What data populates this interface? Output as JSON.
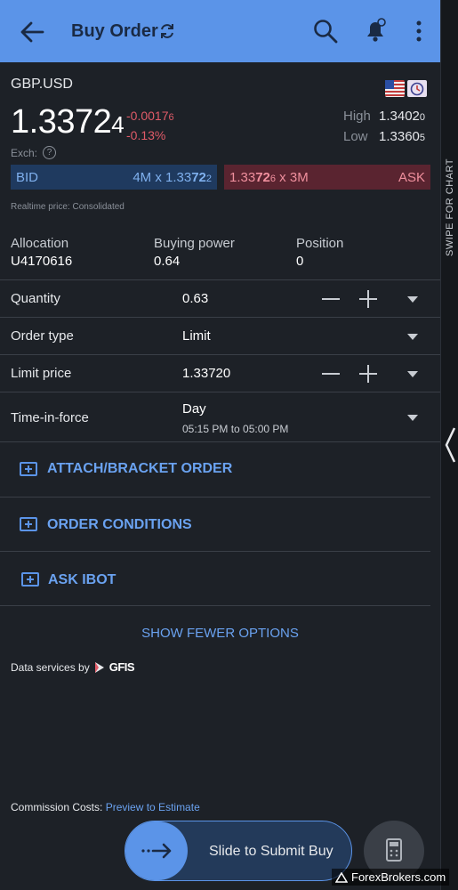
{
  "header": {
    "title": "Buy Order",
    "icons": [
      "back-arrow-icon",
      "refresh-icon",
      "search-icon",
      "bell-icon",
      "more-vert-icon"
    ]
  },
  "side_panel": {
    "label": "SWIPE FOR CHART"
  },
  "quote": {
    "symbol": "GBP.USD",
    "price_main": "1.3372",
    "price_pip": "4",
    "change_abs_main": "-0.0017",
    "change_abs_pip": "6",
    "change_pct": "-0.13%",
    "high_label": "High",
    "high_main": "1.3402",
    "high_pip": "0",
    "low_label": "Low",
    "low_main": "1.3360",
    "low_pip": "5",
    "exch_label": "Exch:",
    "exch_help": "?",
    "bid_label": "BID",
    "bid_size": "4M x 1.33",
    "bid_price_bold": "72",
    "bid_price_pip": "2",
    "ask_price_main": "1.33",
    "ask_price_bold": "72",
    "ask_price_pip": "6",
    "ask_size": " x 3M",
    "ask_label": "ASK",
    "realtime_note": "Realtime price: Consolidated"
  },
  "account": {
    "allocation_label": "Allocation",
    "allocation_value": "U4170616",
    "buying_power_label": "Buying power",
    "buying_power_value": "0.64",
    "position_label": "Position",
    "position_value": "0"
  },
  "order": {
    "quantity_label": "Quantity",
    "quantity_value": "0.63",
    "order_type_label": "Order type",
    "order_type_value": "Limit",
    "limit_price_label": "Limit price",
    "limit_price_value": "1.33720",
    "tif_label": "Time-in-force",
    "tif_value": "Day",
    "tif_hours": "05:15 PM to 05:00 PM"
  },
  "sections": {
    "attach": "ATTACH/BRACKET ORDER",
    "conditions": "ORDER CONDITIONS",
    "ibot": "ASK IBOT",
    "fewer": "SHOW FEWER OPTIONS"
  },
  "footer": {
    "data_services": "Data services by",
    "gfis": "GFIS",
    "commission_label": "Commission Costs:",
    "commission_link": "Preview to Estimate",
    "slide_text": "Slide to Submit Buy",
    "watermark": "ForexBrokers.com"
  },
  "colors": {
    "header": "#5b94e8",
    "background": "#1d2127",
    "bid": "#1f3a5f",
    "ask": "#5a2430",
    "negative": "#e05b68",
    "link": "#6aa2f0"
  }
}
